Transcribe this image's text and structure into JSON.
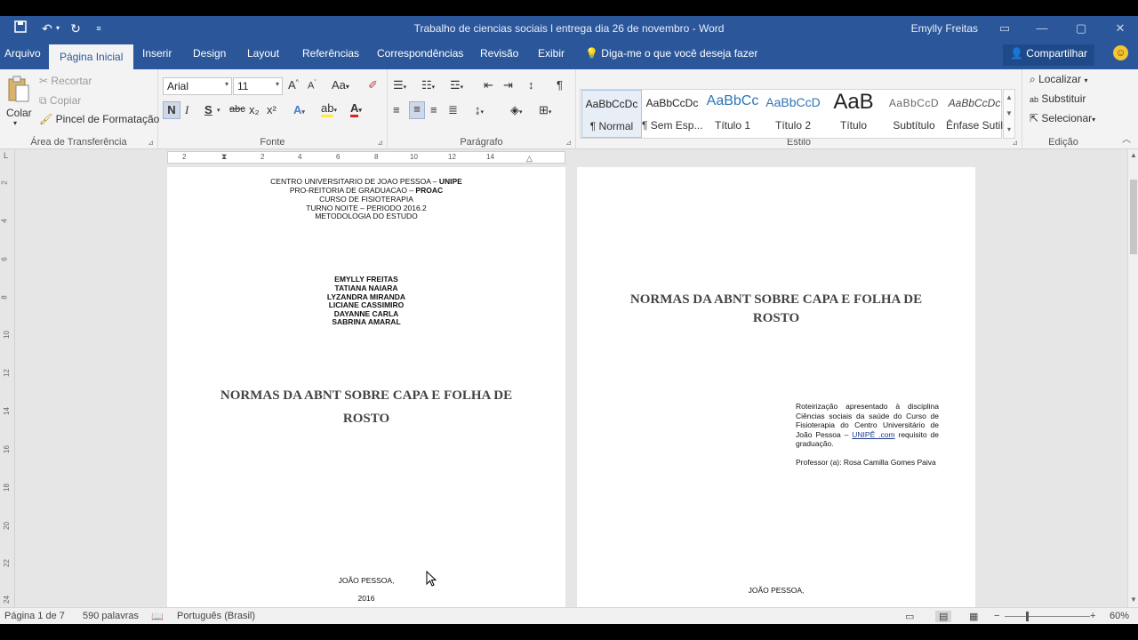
{
  "window": {
    "title": "Trabalho de ciencias sociais l entrega dia 26 de novembro  -  Word",
    "user": "Emylly Freitas"
  },
  "quick_access": {
    "save_icon": "save-icon",
    "undo_icon": "undo-icon",
    "redo_icon": "redo-icon",
    "customize_icon": "customize-icon"
  },
  "tabs": [
    "Arquivo",
    "Página Inicial",
    "Inserir",
    "Design",
    "Layout",
    "Referências",
    "Correspondências",
    "Revisão",
    "Exibir"
  ],
  "tell_me": "Diga-me o que você deseja fazer",
  "share": "Compartilhar",
  "clipboard": {
    "paste": "Colar",
    "cut": "Recortar",
    "copy": "Copiar",
    "format_painter": "Pincel de Formatação",
    "label": "Área de Transferência"
  },
  "font": {
    "name": "Arial",
    "size": "11",
    "label": "Fonte",
    "bold": "N",
    "italic": "I",
    "underline": "S",
    "strike": "abc",
    "sub": "x₂",
    "sup": "x²",
    "case": "Aa"
  },
  "paragraph": {
    "label": "Parágrafo"
  },
  "styles": {
    "label": "Estilo",
    "items": [
      {
        "preview": "AaBbCcDc",
        "name": "¶ Normal"
      },
      {
        "preview": "AaBbCcDc",
        "name": "¶ Sem Esp..."
      },
      {
        "preview": "AaBbCc",
        "name": "Título 1"
      },
      {
        "preview": "AaBbCcD",
        "name": "Título 2"
      },
      {
        "preview": "AaB",
        "name": "Título"
      },
      {
        "preview": "AaBbCcD",
        "name": "Subtítulo"
      },
      {
        "preview": "AaBbCcDc",
        "name": "Ênfase Sutil"
      }
    ]
  },
  "editing": {
    "find": "Localizar",
    "replace": "Substituir",
    "select": "Selecionar",
    "label": "Edição"
  },
  "ruler": {
    "marks": [
      "2",
      "2",
      "4",
      "6",
      "8",
      "10",
      "12",
      "14"
    ]
  },
  "vruler": [
    "2",
    "4",
    "6",
    "8",
    "10",
    "12",
    "14",
    "16",
    "18",
    "20",
    "22",
    "24"
  ],
  "page1": {
    "header": [
      "CENTRO UNIVERSITARIO DE JOAO PESSOA – ",
      "PRO-REITORIA DE GRADUACAO – ",
      "CURSO DE FISIOTERAPIA",
      "TURNO NOITE – PERIODO 2016.2",
      "METODOLOGIA DO ESTUDO"
    ],
    "header_bold": [
      "UNIPE",
      "PROAC"
    ],
    "authors": [
      "EMYLLY FREITAS",
      "TATIANA NAIARA",
      "LYZANDRA MIRANDA",
      "LICIANE CASSIMIRO",
      "DAYANNE CARLA",
      "SABRINA AMARAL"
    ],
    "title": [
      "NORMAS DA ABNT SOBRE CAPA E FOLHA DE",
      "ROSTO"
    ],
    "city": "JOÃO PESSOA,",
    "year": "2016"
  },
  "page2": {
    "title": [
      "NORMAS DA ABNT SOBRE CAPA E FOLHA DE",
      "ROSTO"
    ],
    "note_a": "Roteirização apresentado à disciplina Ciências sociais da saúde do Curso de Fisioterapia do Centro Universitário de João Pessoa – ",
    "note_link": "UNIPÊ .com",
    "note_b": " requisito de graduação.",
    "professor": "Professor (a): Rosa Camilla Gomes Paiva",
    "city": "JOÃO PESSOA,"
  },
  "status": {
    "page": "Página 1 de 7",
    "words": "590 palavras",
    "language": "Português (Brasil)",
    "zoom": "60%"
  }
}
